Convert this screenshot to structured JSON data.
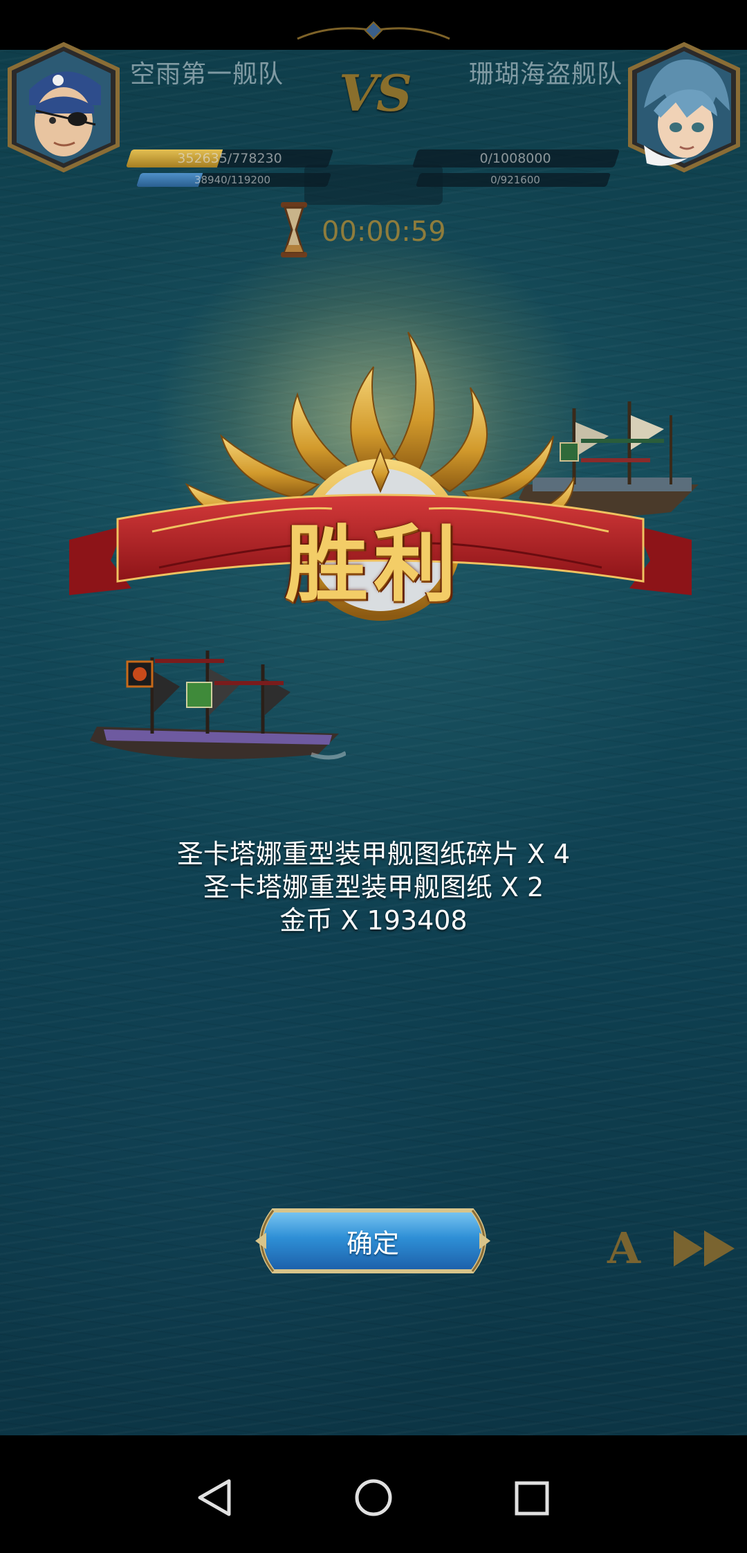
{
  "header": {
    "left_team": "空雨第一舰队",
    "right_team": "珊瑚海盗舰队",
    "vs": "VS",
    "left_hp": "352635/778230",
    "left_hp_ratio": 0.453,
    "left_energy": "38940/119200",
    "left_energy_ratio": 0.327,
    "right_hp": "0/1008000",
    "right_hp_ratio": 0,
    "right_energy": "0/921600",
    "right_energy_ratio": 0,
    "timer": "00:00:59"
  },
  "result": {
    "title": "胜利"
  },
  "rewards": [
    "圣卡塔娜重型装甲舰图纸碎片 X 4",
    "圣卡塔娜重型装甲舰图纸 X 2",
    "金币 X 193408"
  ],
  "controls": {
    "confirm_label": "确定",
    "auto_label": "A"
  },
  "colors": {
    "hp_bar": "#c9a33a",
    "energy_bar": "#3f7fb5",
    "ribbon": "#b3242a",
    "button": "#2e8fd6"
  },
  "icons": {
    "nav_back": "back-triangle-icon",
    "nav_home": "home-circle-icon",
    "nav_recent": "recent-square-icon",
    "speed": "fast-forward-icon",
    "timer": "hourglass-icon"
  }
}
